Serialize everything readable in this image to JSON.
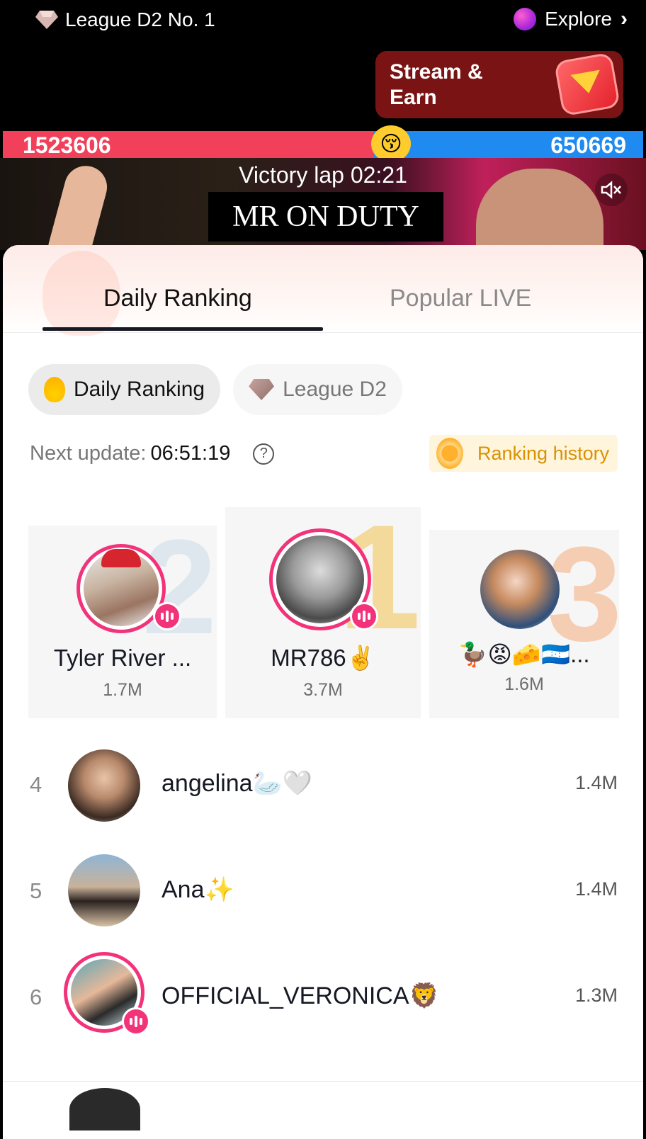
{
  "header": {
    "league_label": "League D2 No. 1",
    "explore_label": "Explore",
    "stream_earn_label": "Stream & Earn"
  },
  "battle": {
    "left_score": "1523606",
    "right_score": "650669",
    "left_share": 0.58,
    "emoji": "😚",
    "left_color": "#f2405a",
    "right_color": "#1f8bf0"
  },
  "video": {
    "victory_text": "Victory lap 02:21",
    "overlay_text": "MR ON DUTY"
  },
  "tabs": [
    {
      "label": "Daily Ranking",
      "active": true
    },
    {
      "label": "Popular LIVE",
      "active": false
    }
  ],
  "chips": [
    {
      "label": "Daily Ranking",
      "active": true
    },
    {
      "label": "League D2",
      "active": false
    }
  ],
  "update": {
    "label": "Next update:",
    "time": "06:51:19",
    "help": "?"
  },
  "history_label": "Ranking history",
  "podium": {
    "first": {
      "rank": "1",
      "name": "MR786✌️",
      "score": "3.7M"
    },
    "second": {
      "rank": "2",
      "name": "Tyler River ...",
      "score": "1.7M"
    },
    "third": {
      "rank": "3",
      "name": "🦆😡🧀🇭🇳...",
      "score": "1.6M"
    }
  },
  "list": [
    {
      "rank": "4",
      "name": "angelina🦢🤍",
      "score": "1.4M",
      "live": false
    },
    {
      "rank": "5",
      "name": "Ana✨",
      "score": "1.4M",
      "live": false
    },
    {
      "rank": "6",
      "name": "OFFICIAL_VERONICA🦁",
      "score": "1.3M",
      "live": true
    }
  ],
  "colors": {
    "accent": "#f2337a",
    "history_text": "#d99100",
    "tab_underline": "#161823"
  }
}
